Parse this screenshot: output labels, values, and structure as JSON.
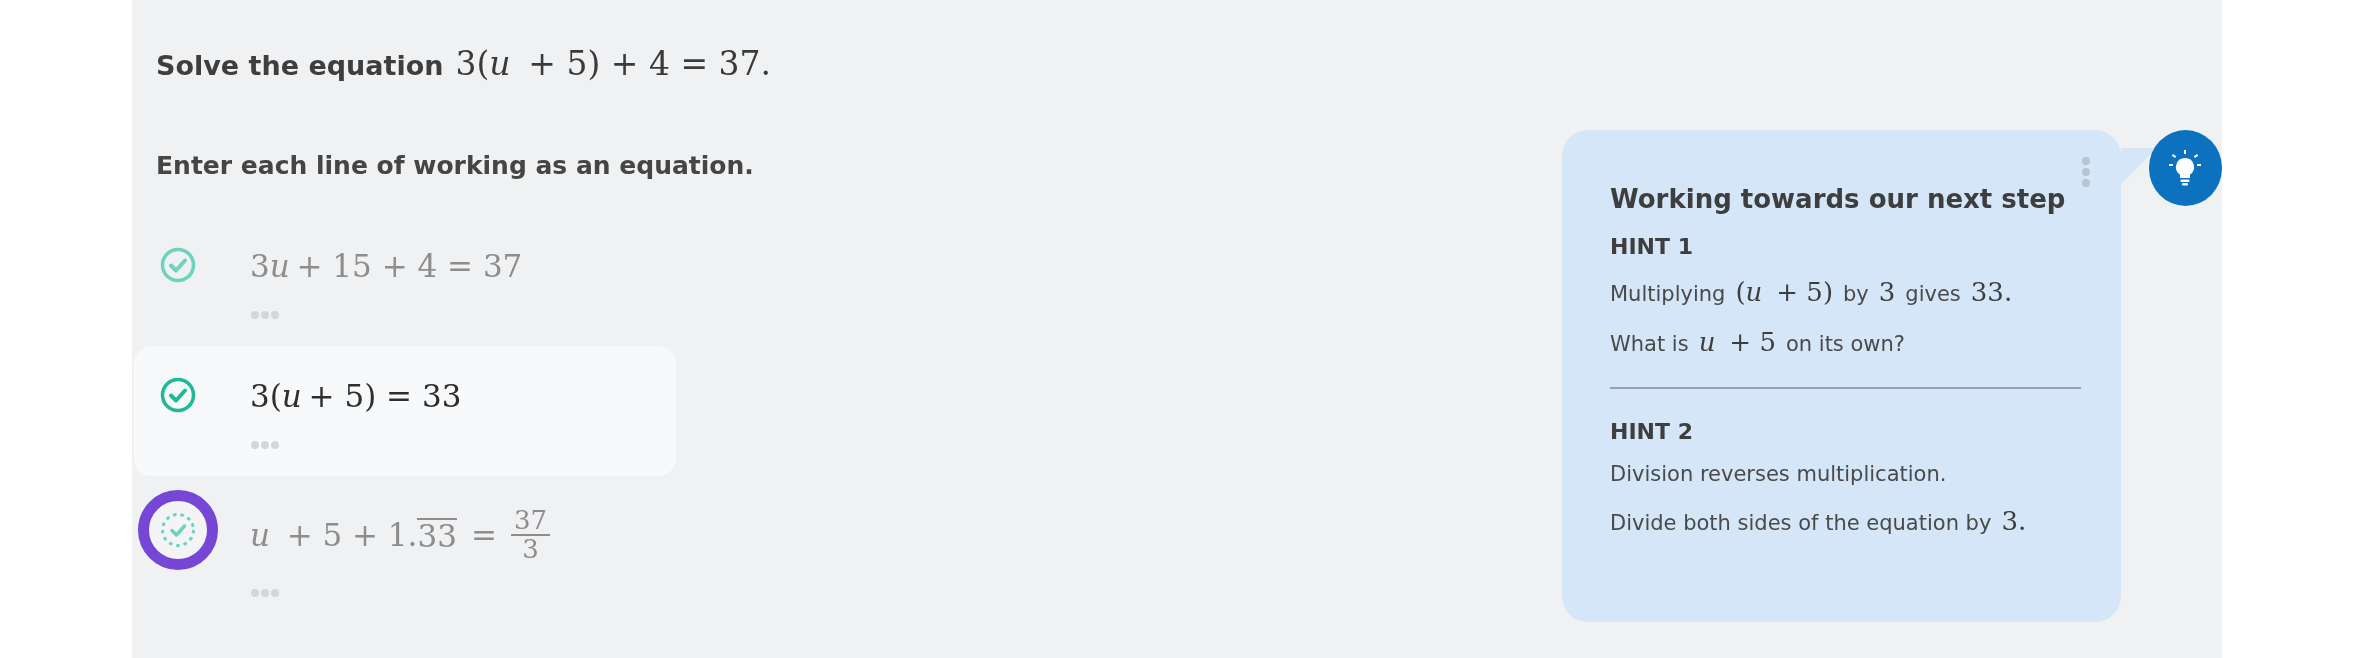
{
  "question": {
    "prompt": "Solve the equation",
    "math": "3(u + 5) + 4 = 37."
  },
  "instruction": "Enter each line of working as an equation.",
  "steps": [
    {
      "kind": "plain",
      "math": "3u + 15 + 4 = 37",
      "verified": true,
      "selected": false,
      "focused": false
    },
    {
      "kind": "plain",
      "math": "3(u + 5) = 33",
      "verified": true,
      "selected": true,
      "focused": false
    },
    {
      "kind": "fraction",
      "math": "u + 5 + 1.",
      "repeating": "33",
      "relation": "=",
      "numerator": "37",
      "denominator": "3",
      "verified": false,
      "selected": false,
      "focused": true
    }
  ],
  "hint_panel": {
    "title": "Working towards our next step",
    "hints": [
      {
        "label": "HINT 1",
        "lines": [
          [
            {
              "kind": "text",
              "text": "Multiplying"
            },
            {
              "kind": "math",
              "text": "(u + 5)"
            },
            {
              "kind": "text",
              "text": "by"
            },
            {
              "kind": "math",
              "text": "3"
            },
            {
              "kind": "text",
              "text": "gives"
            },
            {
              "kind": "math",
              "text": "33."
            }
          ],
          [
            {
              "kind": "text",
              "text": "What is"
            },
            {
              "kind": "math",
              "text": "u + 5"
            },
            {
              "kind": "text",
              "text": "on its own?"
            }
          ]
        ]
      },
      {
        "label": "HINT 2",
        "lines": [
          [
            {
              "kind": "text",
              "text": "Division reverses multiplication."
            }
          ],
          [
            {
              "kind": "text",
              "text": "Divide both sides of the equation by"
            },
            {
              "kind": "math",
              "text": "3."
            }
          ]
        ]
      }
    ]
  }
}
